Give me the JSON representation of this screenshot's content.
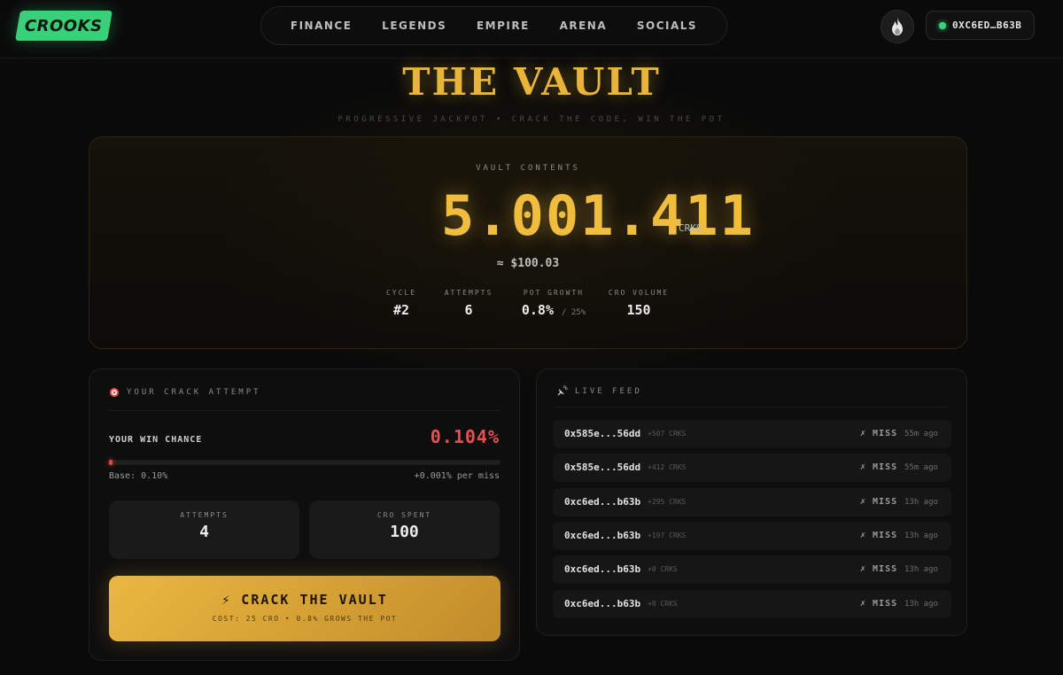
{
  "header": {
    "logo": "CROOKS",
    "nav": [
      "FINANCE",
      "LEGENDS",
      "EMPIRE",
      "ARENA",
      "SOCIALS"
    ],
    "fire_icon": "flame-icon",
    "wallet": "0XC6ED…B63B",
    "wallet_status_color": "#36d67a"
  },
  "hero": {
    "title": "THE VAULT",
    "subtitle": "PROGRESSIVE JACKPOT • CRACK THE CODE, WIN THE POT"
  },
  "vault": {
    "label": "VAULT CONTENTS",
    "amount": "5.001.411",
    "unit": "CRKS",
    "usd": "≈ $100.03",
    "stats": [
      {
        "label": "CYCLE",
        "value": "#2",
        "sub": ""
      },
      {
        "label": "ATTEMPTS",
        "value": "6",
        "sub": ""
      },
      {
        "label": "POT GROWTH",
        "value": "0.8%",
        "sub": "/ 25%"
      },
      {
        "label": "CRO VOLUME",
        "value": "150",
        "sub": ""
      }
    ]
  },
  "attempt": {
    "heading": "YOUR CRACK ATTEMPT",
    "heading_icon": "target-icon",
    "win_label": "YOUR WIN CHANCE",
    "win_value": "0.104%",
    "win_fraction": 0.00104,
    "base": "Base: 0.10%",
    "increment": "+0.001% per miss",
    "attempts_label": "ATTEMPTS",
    "attempts_value": "4",
    "spent_label": "CRO SPENT",
    "spent_value": "100",
    "button_label": "⚡ CRACK THE VAULT",
    "button_sub": "COST: 25 CRO • 0.8% GROWS THE POT"
  },
  "feed": {
    "heading": "LIVE FEED",
    "heading_icon": "satellite-icon",
    "rows": [
      {
        "addr": "0x585e...56dd",
        "amount": "+507 CRKS",
        "result": "✗ MISS",
        "time": "55m ago"
      },
      {
        "addr": "0x585e...56dd",
        "amount": "+412 CRKS",
        "result": "✗ MISS",
        "time": "55m ago"
      },
      {
        "addr": "0xc6ed...b63b",
        "amount": "+295 CRKS",
        "result": "✗ MISS",
        "time": "13h ago"
      },
      {
        "addr": "0xc6ed...b63b",
        "amount": "+197 CRKS",
        "result": "✗ MISS",
        "time": "13h ago"
      },
      {
        "addr": "0xc6ed...b63b",
        "amount": "+0 CRKS",
        "result": "✗ MISS",
        "time": "13h ago"
      },
      {
        "addr": "0xc6ed...b63b",
        "amount": "+0 CRKS",
        "result": "✗ MISS",
        "time": "13h ago"
      }
    ]
  },
  "colors": {
    "gold": "#f0bd3e",
    "danger": "#e45050",
    "logo_green": "#3ad07a"
  }
}
